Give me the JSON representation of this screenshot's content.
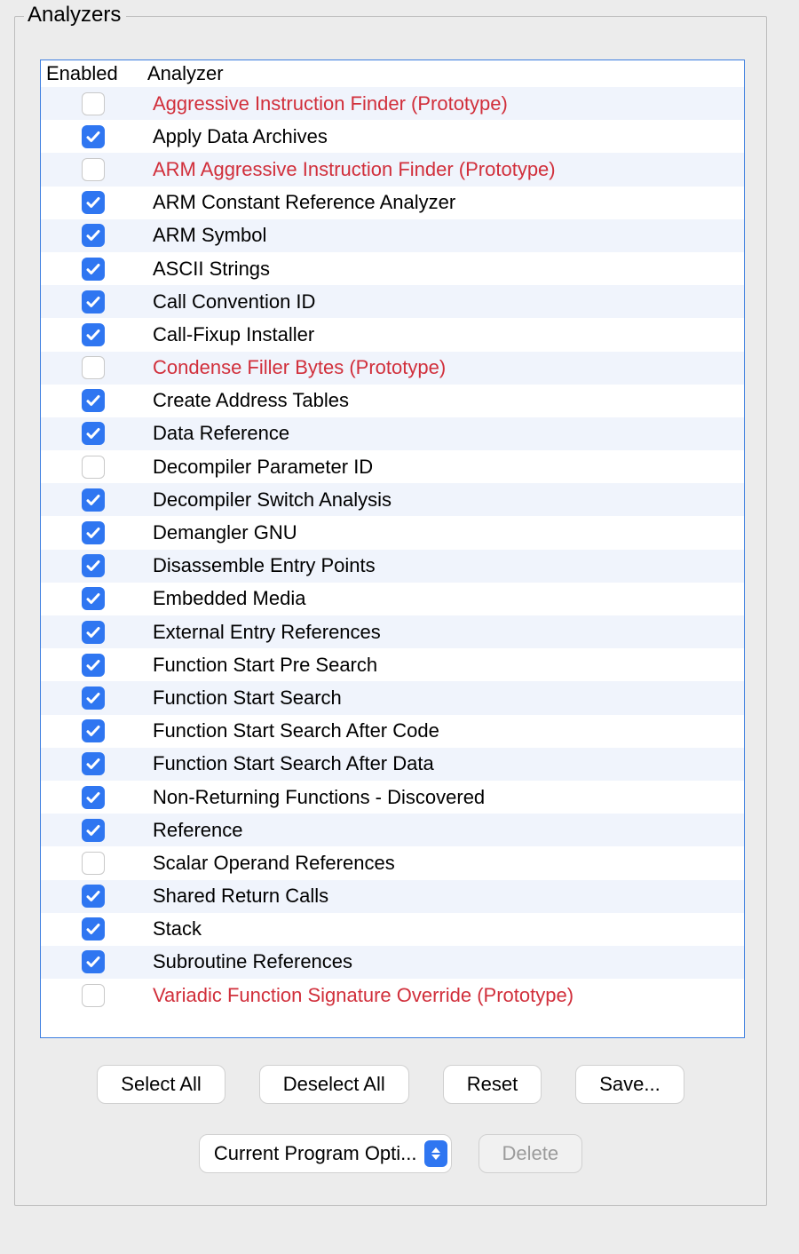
{
  "panel": {
    "title": "Analyzers"
  },
  "columns": {
    "enabled": "Enabled",
    "analyzer": "Analyzer"
  },
  "rows": [
    {
      "enabled": false,
      "label": "Aggressive Instruction Finder (Prototype)",
      "prototype": true
    },
    {
      "enabled": true,
      "label": "Apply Data Archives",
      "prototype": false
    },
    {
      "enabled": false,
      "label": "ARM Aggressive Instruction Finder (Prototype)",
      "prototype": true
    },
    {
      "enabled": true,
      "label": "ARM Constant Reference Analyzer",
      "prototype": false
    },
    {
      "enabled": true,
      "label": "ARM Symbol",
      "prototype": false
    },
    {
      "enabled": true,
      "label": "ASCII Strings",
      "prototype": false
    },
    {
      "enabled": true,
      "label": "Call Convention ID",
      "prototype": false
    },
    {
      "enabled": true,
      "label": "Call-Fixup Installer",
      "prototype": false
    },
    {
      "enabled": false,
      "label": "Condense Filler Bytes (Prototype)",
      "prototype": true
    },
    {
      "enabled": true,
      "label": "Create Address Tables",
      "prototype": false
    },
    {
      "enabled": true,
      "label": "Data Reference",
      "prototype": false
    },
    {
      "enabled": false,
      "label": "Decompiler Parameter ID",
      "prototype": false
    },
    {
      "enabled": true,
      "label": "Decompiler Switch Analysis",
      "prototype": false
    },
    {
      "enabled": true,
      "label": "Demangler GNU",
      "prototype": false
    },
    {
      "enabled": true,
      "label": "Disassemble Entry Points",
      "prototype": false
    },
    {
      "enabled": true,
      "label": "Embedded Media",
      "prototype": false
    },
    {
      "enabled": true,
      "label": "External Entry References",
      "prototype": false
    },
    {
      "enabled": true,
      "label": "Function Start Pre Search",
      "prototype": false
    },
    {
      "enabled": true,
      "label": "Function Start Search",
      "prototype": false
    },
    {
      "enabled": true,
      "label": "Function Start Search After Code",
      "prototype": false
    },
    {
      "enabled": true,
      "label": "Function Start Search After Data",
      "prototype": false
    },
    {
      "enabled": true,
      "label": "Non-Returning Functions - Discovered",
      "prototype": false
    },
    {
      "enabled": true,
      "label": "Reference",
      "prototype": false
    },
    {
      "enabled": false,
      "label": "Scalar Operand References",
      "prototype": false
    },
    {
      "enabled": true,
      "label": "Shared Return Calls",
      "prototype": false
    },
    {
      "enabled": true,
      "label": "Stack",
      "prototype": false
    },
    {
      "enabled": true,
      "label": "Subroutine References",
      "prototype": false
    },
    {
      "enabled": false,
      "label": "Variadic Function Signature Override (Prototype)",
      "prototype": true
    }
  ],
  "buttons": {
    "select_all": "Select All",
    "deselect_all": "Deselect All",
    "reset": "Reset",
    "save": "Save...",
    "delete": "Delete"
  },
  "combo": {
    "full": "Current Program Options",
    "display": "Current Program Opti..."
  }
}
